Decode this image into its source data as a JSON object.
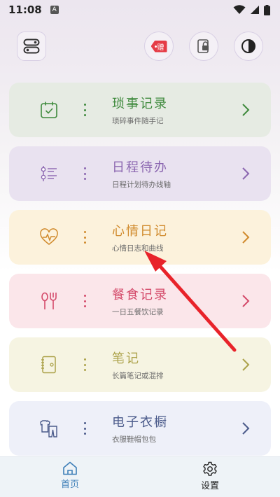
{
  "status_bar": {
    "time": "11:08",
    "notification_badge": "A"
  },
  "top_actions": {
    "gift_label": "赠"
  },
  "cards": [
    {
      "title": "琐事记录",
      "subtitle": "琐碎事件随手记",
      "icon": "calendar-check-icon",
      "accent": "#3f8a3d",
      "bg": "#e6ebe3"
    },
    {
      "title": "日程待办",
      "subtitle": "日程计划待办线轴",
      "icon": "timeline-list-icon",
      "accent": "#8b66b0",
      "bg": "#e9e2f0"
    },
    {
      "title": "心情日记",
      "subtitle": "心情日志和曲线",
      "icon": "heart-pulse-icon",
      "accent": "#d08a2c",
      "bg": "#fcf2dc"
    },
    {
      "title": "餐食记录",
      "subtitle": "一日五餐饮记录",
      "icon": "fork-spoon-icon",
      "accent": "#d44a6a",
      "bg": "#fbe6ea"
    },
    {
      "title": "笔记",
      "subtitle": "长篇笔记或混排",
      "icon": "notebook-icon",
      "accent": "#aca24a",
      "bg": "#f6f4e2"
    },
    {
      "title": "电子衣橱",
      "subtitle": "衣服鞋帽包包",
      "icon": "clothes-icon",
      "accent": "#4a5a8a",
      "bg": "#eef0f9"
    }
  ],
  "bottom_nav": {
    "home_label": "首页",
    "settings_label": "设置",
    "home_color": "#3e7fb8",
    "settings_color": "#222222"
  },
  "annotation": {
    "arrow_color": "#e8232a"
  }
}
